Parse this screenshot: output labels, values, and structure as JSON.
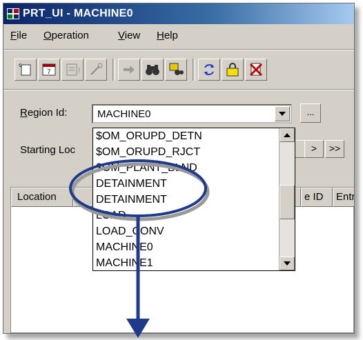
{
  "window": {
    "title": "PRT_UI - MACHINE0"
  },
  "menu": {
    "items": [
      {
        "first": "F",
        "rest": "ile"
      },
      {
        "first": "O",
        "rest": "peration"
      },
      {
        "first": "V",
        "rest": "iew"
      },
      {
        "first": "H",
        "rest": "elp"
      }
    ]
  },
  "toolbar": {
    "icons": [
      "new-doc-icon",
      "calendar-icon",
      "disabled-info-icon",
      "disabled-wand-icon",
      "arrow-right-icon",
      "binoculars-icon",
      "find-icon",
      "refresh-icon",
      "lock-icon",
      "delete-icon"
    ]
  },
  "form": {
    "region_label_first": "R",
    "region_label_rest": "egion Id:",
    "region_value": "MACHINE0",
    "ellipsis": "...",
    "starting_loc_label": "Starting Loc",
    "next": ">",
    "last": ">>"
  },
  "table": {
    "headers": [
      "Location",
      "e ID",
      "Entr"
    ]
  },
  "dropdown": {
    "items": [
      "$OM_ORUPD_DETN",
      "$OM_ORUPD_RJCT",
      "$OM_PLANT_BLND",
      "DETAINMENT",
      "DETAINMENT",
      "LOAD",
      "LOAD_CONV",
      "MACHINE0",
      "MACHINE1"
    ],
    "highlighted": [
      3,
      4
    ]
  },
  "annotation": {
    "color": "#1f3a8a",
    "shadow": "#9a9a9a"
  }
}
